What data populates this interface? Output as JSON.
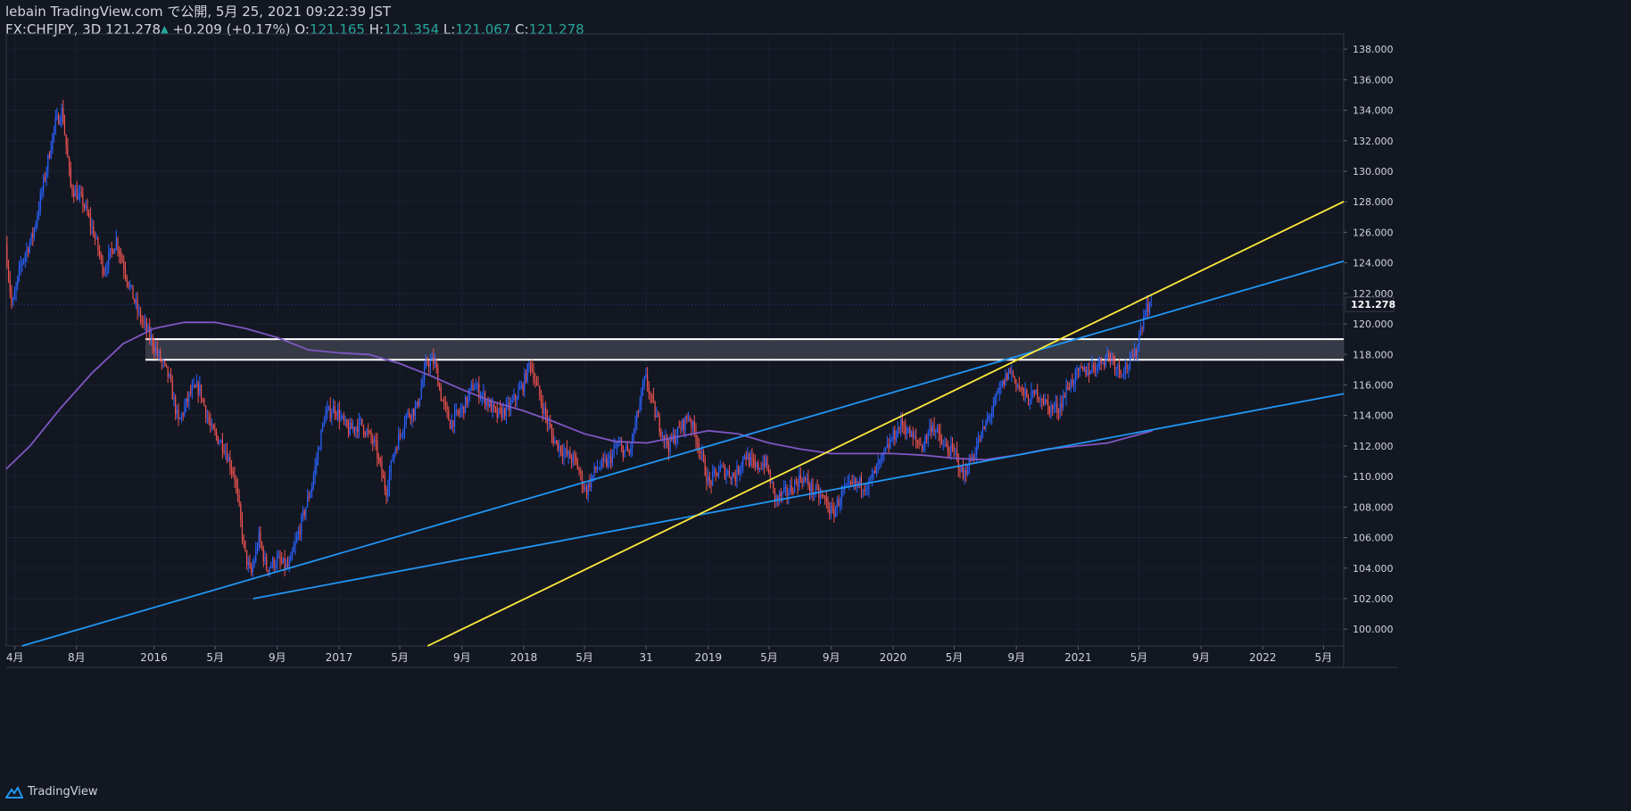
{
  "header": {
    "line1": "lebain TradingView.com で公開, 5月 25, 2021 09:22:39 JST",
    "symbol": "FX:CHFJPY, 3D",
    "last": "121.278",
    "change_arrow": "▲",
    "change": "+0.209 (+0.17%)",
    "o_label": "O:",
    "o_value": "121.165",
    "h_label": "H:",
    "h_value": "121.354",
    "l_label": "L:",
    "l_value": "121.067",
    "c_label": "C:",
    "c_value": "121.278"
  },
  "footer": {
    "logo_text": "TradingView",
    "logo_icon": "tradingview-logo-icon"
  },
  "colors": {
    "background": "#131722",
    "grid": "#1c2030",
    "up_candle": "#2962ff",
    "down_candle": "#ef5350",
    "trendline_blue": "#2196f3",
    "trendline_yellow": "#ffeb3b",
    "moving_average": "#7e57c2",
    "zone_fill": "#3a3e4a",
    "zone_border": "#ffffff",
    "axis_text": "#d1d4dc"
  },
  "chart_data": {
    "type": "candlestick",
    "title": "",
    "xlabel": "",
    "ylabel": "",
    "ylim": [
      98.9,
      139
    ],
    "x_range": [
      "2015-03-15",
      "2022-06-10"
    ],
    "price_ticks": [
      "100.000",
      "102.000",
      "104.000",
      "106.000",
      "108.000",
      "110.000",
      "112.000",
      "114.000",
      "116.000",
      "118.000",
      "120.000",
      "122.000",
      "124.000",
      "126.000",
      "128.000",
      "130.000",
      "132.000",
      "134.000",
      "136.000",
      "138.000"
    ],
    "time_ticks": [
      {
        "label": "4月",
        "date": "2015-04-01"
      },
      {
        "label": "8月",
        "date": "2015-08-01"
      },
      {
        "label": "2016",
        "date": "2016-01-01"
      },
      {
        "label": "5月",
        "date": "2016-05-01"
      },
      {
        "label": "9月",
        "date": "2016-09-01"
      },
      {
        "label": "2017",
        "date": "2017-01-01"
      },
      {
        "label": "5月",
        "date": "2017-05-01"
      },
      {
        "label": "9月",
        "date": "2017-09-01"
      },
      {
        "label": "2018",
        "date": "2018-01-01"
      },
      {
        "label": "5月",
        "date": "2018-05-01"
      },
      {
        "label": "31",
        "date": "2018-08-31"
      },
      {
        "label": "2019",
        "date": "2019-01-01"
      },
      {
        "label": "5月",
        "date": "2019-05-01"
      },
      {
        "label": "9月",
        "date": "2019-09-01"
      },
      {
        "label": "2020",
        "date": "2020-01-01"
      },
      {
        "label": "5月",
        "date": "2020-05-01"
      },
      {
        "label": "9月",
        "date": "2020-09-01"
      },
      {
        "label": "2021",
        "date": "2021-01-01"
      },
      {
        "label": "5月",
        "date": "2021-05-01"
      },
      {
        "label": "9月",
        "date": "2021-09-01"
      },
      {
        "label": "2022",
        "date": "2022-01-01"
      },
      {
        "label": "5月",
        "date": "2022-05-01"
      }
    ],
    "last_price": 121.278,
    "last_price_label": "121.278",
    "interval_days": 3,
    "price_path": [
      [
        "2015-03-15",
        125.2
      ],
      [
        "2015-03-28",
        121.0
      ],
      [
        "2015-04-15",
        124.0
      ],
      [
        "2015-05-08",
        125.8
      ],
      [
        "2015-05-25",
        128.5
      ],
      [
        "2015-06-20",
        133.0
      ],
      [
        "2015-07-05",
        134.0
      ],
      [
        "2015-07-22",
        129.0
      ],
      [
        "2015-08-15",
        128.0
      ],
      [
        "2015-09-05",
        126.0
      ],
      [
        "2015-09-25",
        123.5
      ],
      [
        "2015-10-20",
        125.5
      ],
      [
        "2015-11-15",
        122.5
      ],
      [
        "2015-12-05",
        120.5
      ],
      [
        "2015-12-28",
        119.0
      ],
      [
        "2016-01-10",
        118.0
      ],
      [
        "2016-02-01",
        116.5
      ],
      [
        "2016-02-20",
        113.5
      ],
      [
        "2016-03-15",
        115.5
      ],
      [
        "2016-04-01",
        115.8
      ],
      [
        "2016-04-25",
        113.0
      ],
      [
        "2016-05-20",
        112.0
      ],
      [
        "2016-06-10",
        110.0
      ],
      [
        "2016-06-30",
        105.0
      ],
      [
        "2016-07-12",
        103.5
      ],
      [
        "2016-07-28",
        106.0
      ],
      [
        "2016-08-12",
        104.0
      ],
      [
        "2016-09-01",
        104.5
      ],
      [
        "2016-09-25",
        104.0
      ],
      [
        "2016-10-20",
        107.0
      ],
      [
        "2016-11-10",
        109.5
      ],
      [
        "2016-12-05",
        114.0
      ],
      [
        "2016-12-25",
        114.5
      ],
      [
        "2017-01-20",
        113.0
      ],
      [
        "2017-02-15",
        113.5
      ],
      [
        "2017-03-15",
        112.0
      ],
      [
        "2017-04-05",
        109.0
      ],
      [
        "2017-04-20",
        111.5
      ],
      [
        "2017-05-15",
        114.0
      ],
      [
        "2017-06-05",
        114.5
      ],
      [
        "2017-06-25",
        117.5
      ],
      [
        "2017-07-10",
        117.5
      ],
      [
        "2017-07-25",
        115.0
      ],
      [
        "2017-08-10",
        113.5
      ],
      [
        "2017-09-05",
        114.5
      ],
      [
        "2017-09-25",
        116.0
      ],
      [
        "2017-10-20",
        115.0
      ],
      [
        "2017-11-10",
        114.0
      ],
      [
        "2017-12-05",
        114.5
      ],
      [
        "2018-01-01",
        116.0
      ],
      [
        "2018-01-15",
        117.5
      ],
      [
        "2018-02-05",
        115.0
      ],
      [
        "2018-03-01",
        112.5
      ],
      [
        "2018-03-25",
        111.5
      ],
      [
        "2018-04-15",
        111.0
      ],
      [
        "2018-05-05",
        109.0
      ],
      [
        "2018-05-25",
        110.5
      ],
      [
        "2018-06-20",
        111.0
      ],
      [
        "2018-07-05",
        112.0
      ],
      [
        "2018-07-30",
        111.5
      ],
      [
        "2018-08-15",
        114.0
      ],
      [
        "2018-08-31",
        116.5
      ],
      [
        "2018-09-20",
        114.0
      ],
      [
        "2018-10-15",
        112.0
      ],
      [
        "2018-11-05",
        113.0
      ],
      [
        "2018-11-25",
        114.0
      ],
      [
        "2018-12-15",
        112.0
      ],
      [
        "2019-01-03",
        109.5
      ],
      [
        "2019-01-25",
        110.5
      ],
      [
        "2019-02-25",
        110.0
      ],
      [
        "2019-03-15",
        111.5
      ],
      [
        "2019-04-05",
        110.5
      ],
      [
        "2019-04-25",
        111.0
      ],
      [
        "2019-05-15",
        108.5
      ],
      [
        "2019-06-10",
        109.0
      ],
      [
        "2019-07-05",
        110.0
      ],
      [
        "2019-07-30",
        109.0
      ],
      [
        "2019-08-20",
        108.5
      ],
      [
        "2019-09-05",
        107.5
      ],
      [
        "2019-09-25",
        109.0
      ],
      [
        "2019-10-20",
        109.5
      ],
      [
        "2019-11-15",
        109.5
      ],
      [
        "2019-12-10",
        111.0
      ],
      [
        "2020-01-01",
        112.5
      ],
      [
        "2020-01-20",
        113.5
      ],
      [
        "2020-02-10",
        112.5
      ],
      [
        "2020-03-01",
        112.0
      ],
      [
        "2020-03-20",
        113.5
      ],
      [
        "2020-04-10",
        112.0
      ],
      [
        "2020-05-05",
        111.5
      ],
      [
        "2020-05-20",
        110.0
      ],
      [
        "2020-06-10",
        111.5
      ],
      [
        "2020-07-05",
        113.5
      ],
      [
        "2020-07-30",
        115.5
      ],
      [
        "2020-08-20",
        117.0
      ],
      [
        "2020-09-05",
        116.0
      ],
      [
        "2020-09-25",
        115.0
      ],
      [
        "2020-10-15",
        115.5
      ],
      [
        "2020-11-05",
        114.5
      ],
      [
        "2020-11-25",
        114.5
      ],
      [
        "2020-12-15",
        116.0
      ],
      [
        "2021-01-05",
        116.8
      ],
      [
        "2021-01-25",
        117.0
      ],
      [
        "2021-02-15",
        117.5
      ],
      [
        "2021-03-05",
        118.0
      ],
      [
        "2021-03-25",
        117.0
      ],
      [
        "2021-04-10",
        117.2
      ],
      [
        "2021-04-25",
        118.0
      ],
      [
        "2021-05-05",
        119.5
      ],
      [
        "2021-05-15",
        121.0
      ],
      [
        "2021-05-25",
        121.278
      ]
    ],
    "moving_average": [
      [
        "2015-03-15",
        110.5
      ],
      [
        "2015-05-01",
        112.0
      ],
      [
        "2015-07-01",
        114.5
      ],
      [
        "2015-09-01",
        116.8
      ],
      [
        "2015-11-01",
        118.7
      ],
      [
        "2016-01-01",
        119.7
      ],
      [
        "2016-03-01",
        120.1
      ],
      [
        "2016-05-01",
        120.1
      ],
      [
        "2016-07-01",
        119.7
      ],
      [
        "2016-09-01",
        119.1
      ],
      [
        "2016-11-01",
        118.3
      ],
      [
        "2017-01-01",
        118.1
      ],
      [
        "2017-03-01",
        118.0
      ],
      [
        "2017-05-01",
        117.4
      ],
      [
        "2017-07-01",
        116.6
      ],
      [
        "2017-09-01",
        115.7
      ],
      [
        "2017-11-01",
        114.9
      ],
      [
        "2018-01-01",
        114.3
      ],
      [
        "2018-03-01",
        113.6
      ],
      [
        "2018-05-01",
        112.8
      ],
      [
        "2018-07-01",
        112.3
      ],
      [
        "2018-09-01",
        112.2
      ],
      [
        "2018-11-01",
        112.6
      ],
      [
        "2019-01-01",
        113.0
      ],
      [
        "2019-03-01",
        112.8
      ],
      [
        "2019-05-01",
        112.2
      ],
      [
        "2019-07-01",
        111.8
      ],
      [
        "2019-09-01",
        111.5
      ],
      [
        "2019-11-01",
        111.5
      ],
      [
        "2020-01-01",
        111.5
      ],
      [
        "2020-03-01",
        111.4
      ],
      [
        "2020-05-01",
        111.2
      ],
      [
        "2020-07-01",
        111.1
      ],
      [
        "2020-09-01",
        111.4
      ],
      [
        "2020-11-01",
        111.8
      ],
      [
        "2021-01-01",
        112.0
      ],
      [
        "2021-03-01",
        112.2
      ],
      [
        "2021-05-28",
        113.0
      ]
    ],
    "trendlines": [
      {
        "color": "blue",
        "p1": [
          "2015-04-15",
          98.9
        ],
        "p2": [
          "2021-05-01",
          120.2
        ],
        "extend_right": true
      },
      {
        "color": "blue",
        "p1": [
          "2016-07-15",
          102.0
        ],
        "p2": [
          "2021-05-01",
          112.9
        ],
        "extend_right": true
      },
      {
        "color": "yellow",
        "p1": [
          "2017-06-25",
          98.9
        ],
        "p2": [
          "2020-08-25",
          117.5
        ],
        "extend_right": true
      }
    ],
    "zone": {
      "low": 117.65,
      "high": 119.0,
      "from": "2015-12-15",
      "to": "2021-05-28"
    }
  }
}
